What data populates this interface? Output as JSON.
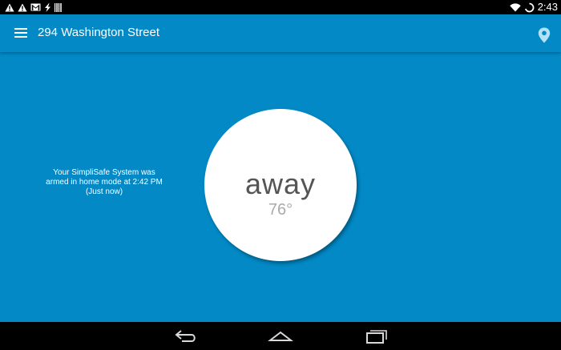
{
  "status_bar": {
    "time": "2:43",
    "left_icons": [
      "warning-icon",
      "warning-icon",
      "gmail-icon",
      "signal-bolt-icon",
      "barcode-icon"
    ],
    "right_icons": [
      "wifi-icon",
      "sync-icon"
    ]
  },
  "app_bar": {
    "title": "294 Washington Street",
    "menu_icon": "hamburger-menu-icon",
    "location_icon": "location-pin-icon"
  },
  "main": {
    "status_message": {
      "line1": "Your SimpliSafe System was",
      "line2": "armed in home mode at 2:42 PM",
      "line3": "(Just now)"
    },
    "mode": "away",
    "temperature": "76°"
  },
  "nav_bar": {
    "icons": [
      "back-icon",
      "home-icon",
      "recents-icon"
    ]
  },
  "colors": {
    "primary": "#0289c6",
    "circle": "#ffffff",
    "mode_text": "#555555",
    "temp_text": "#aaaaaa"
  }
}
